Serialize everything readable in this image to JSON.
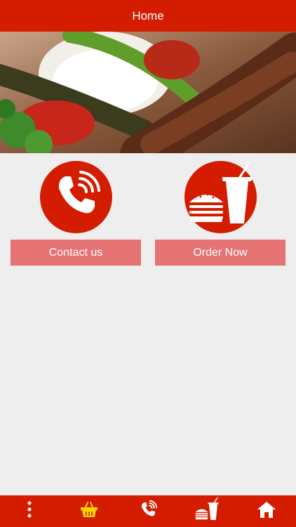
{
  "header": {
    "title": "Home"
  },
  "tiles": [
    {
      "id": "contact",
      "label": "Contact us",
      "icon": "phone-icon"
    },
    {
      "id": "order",
      "label": "Order Now",
      "icon": "burger-drink-icon"
    }
  ],
  "bottom_nav": [
    {
      "id": "menu",
      "icon": "more-vertical-icon"
    },
    {
      "id": "basket",
      "icon": "basket-icon"
    },
    {
      "id": "call",
      "icon": "phone-icon"
    },
    {
      "id": "order",
      "icon": "burger-drink-icon"
    },
    {
      "id": "home",
      "icon": "home-icon"
    }
  ],
  "colors": {
    "primary": "#d41d00",
    "button": "#e57373",
    "background": "#eeeeee",
    "basket_icon": "#ffd600"
  }
}
